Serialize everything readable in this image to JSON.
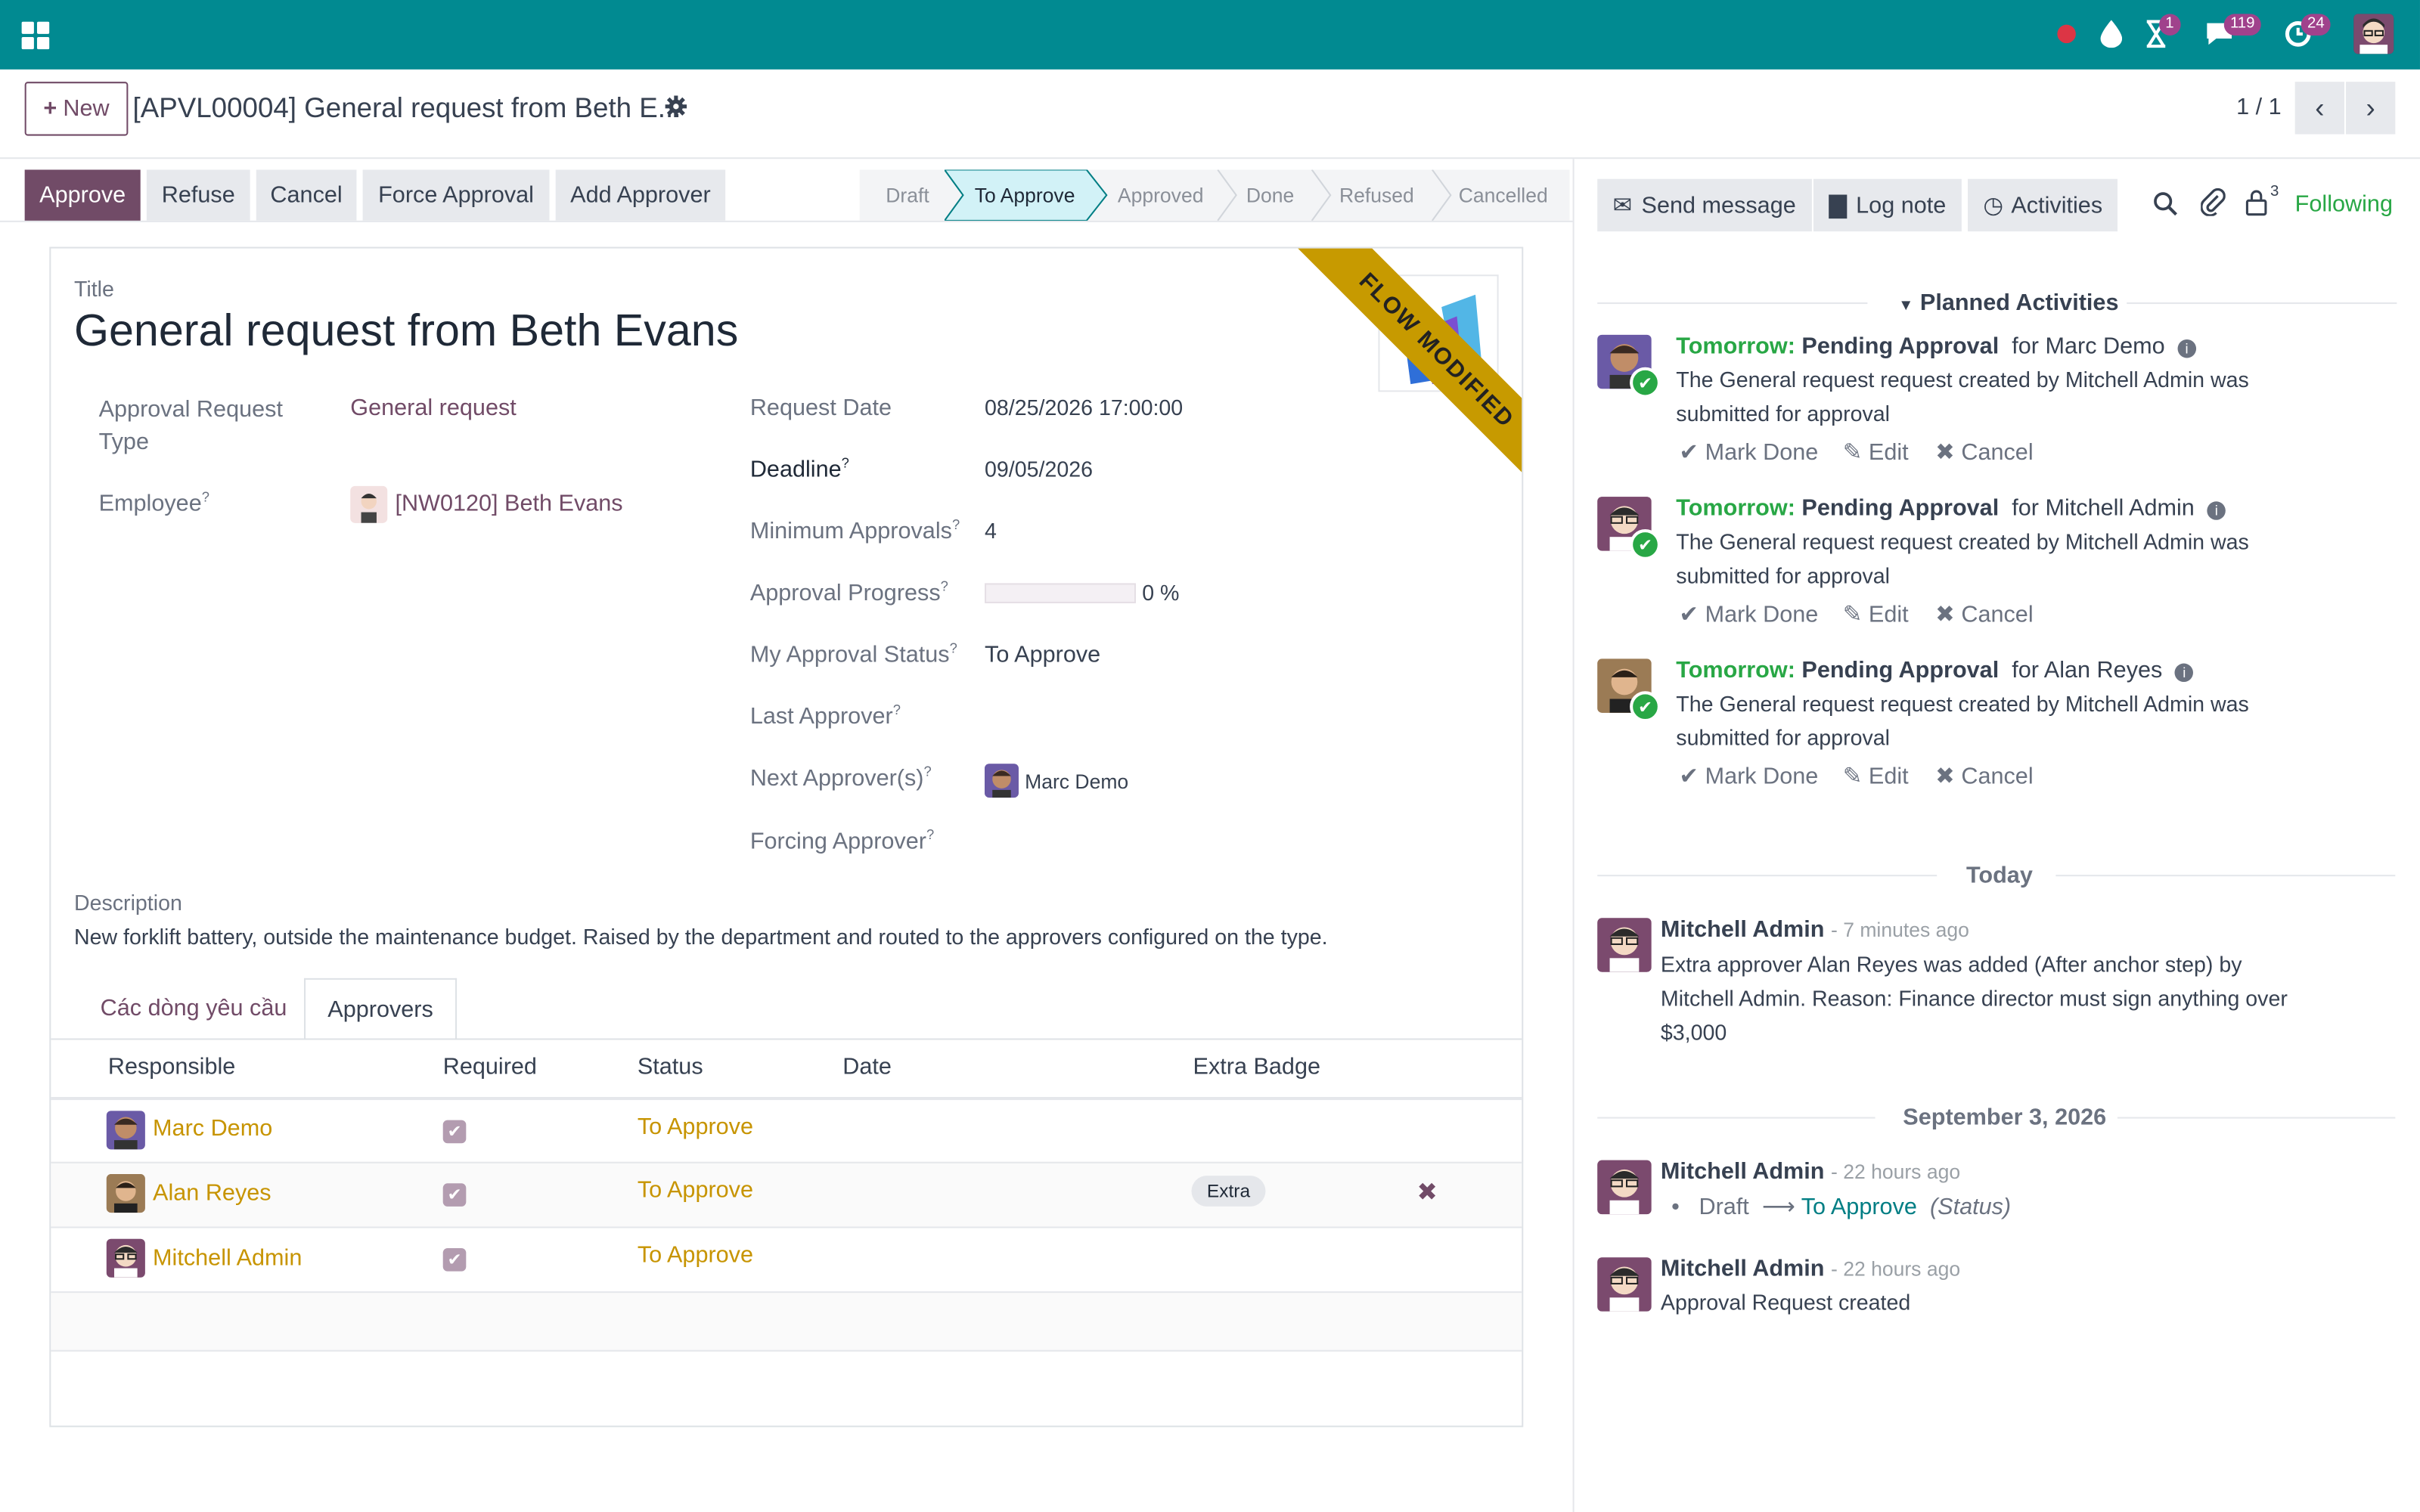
{
  "topbar": {
    "messages_count": "119",
    "activities_count": "24",
    "timer_count": "1"
  },
  "cp": {
    "new_label": "New",
    "record_title": "[APVL00004] General request from Beth E...",
    "pager": "1 / 1"
  },
  "actions": {
    "approve": "Approve",
    "refuse": "Refuse",
    "cancel": "Cancel",
    "force": "Force Approval",
    "add": "Add Approver"
  },
  "statusbar": [
    "Draft",
    "To Approve",
    "Approved",
    "Done",
    "Refused",
    "Cancelled"
  ],
  "ribbon": "FLOW MODIFIED",
  "form": {
    "title_label": "Title",
    "title": "General request from Beth Evans",
    "type_label": "Approval Request Type",
    "type_value": "General request",
    "employee_label": "Employee",
    "employee_value": "[NW0120] Beth Evans",
    "request_date_label": "Request Date",
    "request_date": "08/25/2026 17:00:00",
    "deadline_label": "Deadline",
    "deadline": "09/05/2026",
    "min_label": "Minimum Approvals",
    "min": "4",
    "progress_label": "Approval Progress",
    "progress": "0 %",
    "progress_fraction": 0,
    "my_status_label": "My Approval Status",
    "my_status": "To Approve",
    "last_label": "Last Approver",
    "next_label": "Next Approver(s)",
    "next": "Marc Demo",
    "forcing_label": "Forcing Approver",
    "desc_label": "Description",
    "desc": "New forklift battery, outside the maintenance budget. Raised by the department and routed to the approvers configured on the type."
  },
  "tabs": [
    "Các dòng yêu cầu",
    "Approvers"
  ],
  "table": {
    "headers": [
      "Responsible",
      "Required",
      "Status",
      "Date",
      "Extra Badge"
    ],
    "rows": [
      {
        "name": "Marc Demo",
        "status": "To Approve",
        "badge": ""
      },
      {
        "name": "Alan Reyes",
        "status": "To Approve",
        "badge": "Extra"
      },
      {
        "name": "Mitchell Admin",
        "status": "To Approve",
        "badge": ""
      }
    ]
  },
  "chatter": {
    "send": "Send message",
    "log": "Log note",
    "activities": "Activities",
    "followers": "3",
    "following": "Following",
    "planned": "Planned Activities",
    "activities_list": [
      {
        "when": "Tomorrow:",
        "title": "Pending Approval",
        "for": "for Marc Demo",
        "text": "The General request request created by Mitchell Admin was submitted for approval"
      },
      {
        "when": "Tomorrow:",
        "title": "Pending Approval",
        "for": "for Mitchell Admin",
        "text": "The General request request created by Mitchell Admin was submitted for approval"
      },
      {
        "when": "Tomorrow:",
        "title": "Pending Approval",
        "for": "for Alan Reyes",
        "text": "The General request request created by Mitchell Admin was submitted for approval"
      }
    ],
    "mark_done": "Mark Done",
    "edit": "Edit",
    "cancel": "Cancel",
    "today": "Today",
    "msg1": {
      "author": "Mitchell Admin",
      "time": "- 7 minutes ago",
      "text": "Extra approver Alan Reyes was added (After anchor step) by Mitchell Admin. Reason: Finance director must sign anything over $3,000"
    },
    "date2": "September 3, 2026",
    "msg2": {
      "author": "Mitchell Admin",
      "time": "- 22 hours ago",
      "from": "Draft",
      "to": "To Approve",
      "field": "(Status)"
    },
    "msg3": {
      "author": "Mitchell Admin",
      "time": "- 22 hours ago",
      "text": "Approval Request created"
    }
  }
}
